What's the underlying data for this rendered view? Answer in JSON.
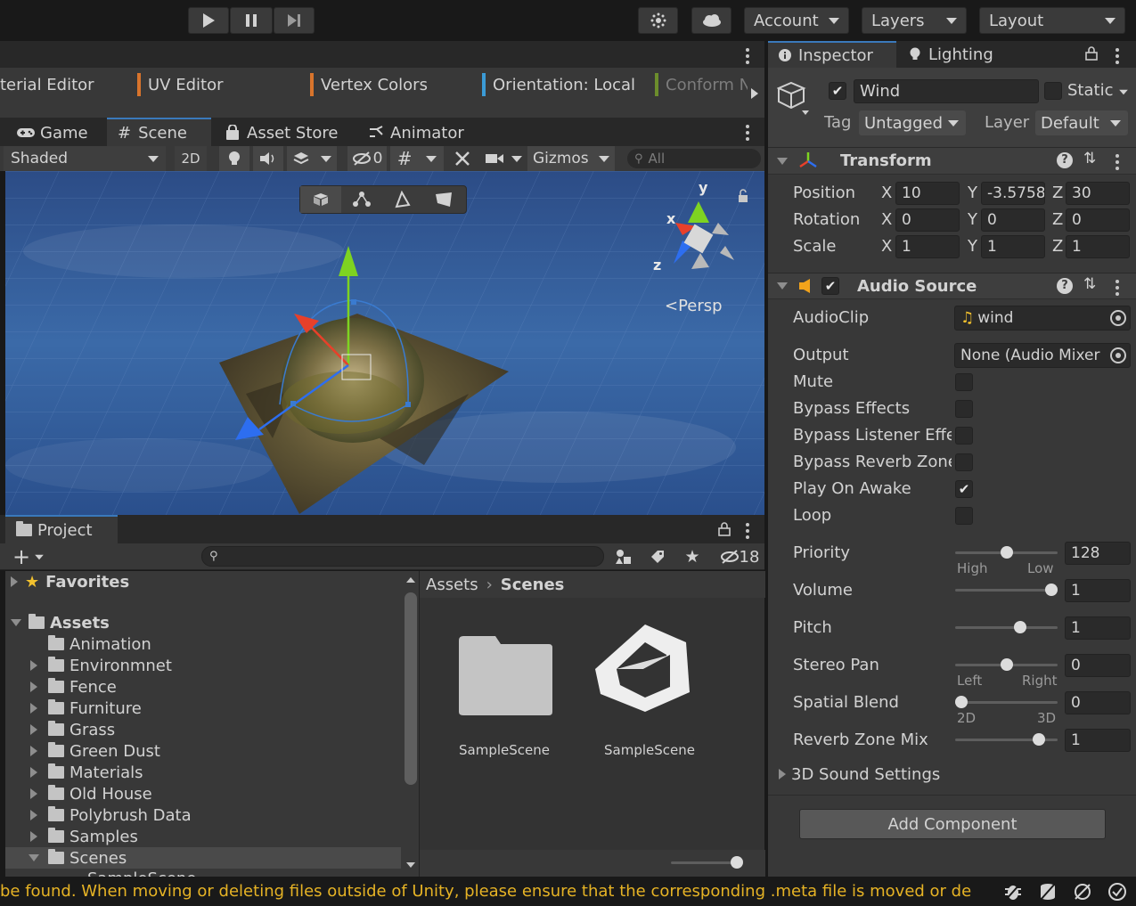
{
  "toolbar": {
    "account_label": "Account",
    "layers_label": "Layers",
    "layout_label": "Layout"
  },
  "polybrush_bar": {
    "items": [
      {
        "label": "terial Editor",
        "color": ""
      },
      {
        "label": "UV Editor",
        "color": "#d8742c"
      },
      {
        "label": "Vertex Colors",
        "color": "#d8742c"
      },
      {
        "label": "Orientation: Local",
        "color": "#3b9bd6"
      },
      {
        "label": "Conform No",
        "color": "#6c8d2c"
      }
    ]
  },
  "scene_tabs": [
    {
      "label": "Game",
      "icon": "gamepad-icon"
    },
    {
      "label": "Scene",
      "icon": "hash-icon"
    },
    {
      "label": "Asset Store",
      "icon": "bag-icon"
    },
    {
      "label": "Animator",
      "icon": "animator-icon"
    }
  ],
  "scene_toolbar": {
    "shading_mode": "Shaded",
    "mode_2d": "2D",
    "hidden_count": "0",
    "gizmos_label": "Gizmos",
    "search_placeholder": "All"
  },
  "scene_view": {
    "projection_label": "Persp",
    "axis_x": "x",
    "axis_y": "y",
    "axis_z": "z",
    "colors": {
      "x_axis": "#e8402a",
      "y_axis": "#7ed321",
      "z_axis": "#2d6ef0",
      "sky": "#3a5a8c"
    }
  },
  "project": {
    "tab_label": "Project",
    "hidden_count": "18",
    "breadcrumb": {
      "root": "Assets",
      "current": "Scenes"
    },
    "tree": [
      {
        "label": "Favorites",
        "level": 0,
        "expand": "collapsed",
        "icon": "star-icon",
        "bold": true
      },
      {
        "label": "Assets",
        "level": 0,
        "expand": "expanded",
        "icon": "folder-open-icon",
        "bold": true
      },
      {
        "label": "Animation",
        "level": 1,
        "expand": "none"
      },
      {
        "label": "Environmnet",
        "level": 1,
        "expand": "collapsed"
      },
      {
        "label": "Fence",
        "level": 1,
        "expand": "collapsed"
      },
      {
        "label": "Furniture",
        "level": 1,
        "expand": "collapsed"
      },
      {
        "label": "Grass",
        "level": 1,
        "expand": "collapsed"
      },
      {
        "label": "Green Dust",
        "level": 1,
        "expand": "collapsed"
      },
      {
        "label": "Materials",
        "level": 1,
        "expand": "collapsed"
      },
      {
        "label": "Old House",
        "level": 1,
        "expand": "collapsed"
      },
      {
        "label": "Polybrush Data",
        "level": 1,
        "expand": "collapsed"
      },
      {
        "label": "Samples",
        "level": 1,
        "expand": "collapsed"
      },
      {
        "label": "Scenes",
        "level": 1,
        "expand": "expanded",
        "selected": true
      },
      {
        "label": "SampleScene",
        "level": 2,
        "expand": "none"
      }
    ],
    "assets": [
      {
        "label": "SampleScene",
        "icon": "folder-icon"
      },
      {
        "label": "SampleScene",
        "icon": "unity-logo-icon"
      }
    ]
  },
  "inspector": {
    "tabs": [
      {
        "label": "Inspector",
        "icon": "info-icon"
      },
      {
        "label": "Lighting",
        "icon": "bulb-icon"
      }
    ],
    "object_name": "Wind",
    "static_label": "Static",
    "tag_label": "Tag",
    "tag_value": "Untagged",
    "layer_label": "Layer",
    "layer_value": "Default",
    "transform": {
      "title": "Transform",
      "rows": [
        {
          "label": "Position",
          "x": "10",
          "y": "-3.5758",
          "z": "30"
        },
        {
          "label": "Rotation",
          "x": "0",
          "y": "0",
          "z": "0"
        },
        {
          "label": "Scale",
          "x": "1",
          "y": "1",
          "z": "1"
        }
      ],
      "axis_labels": {
        "x": "X",
        "y": "Y",
        "z": "Z"
      }
    },
    "audio": {
      "title": "Audio Source",
      "audioclip_label": "AudioClip",
      "audioclip_value": "wind",
      "output_label": "Output",
      "output_value": "None (Audio Mixer",
      "toggles": [
        {
          "label": "Mute",
          "checked": false
        },
        {
          "label": "Bypass Effects",
          "checked": false
        },
        {
          "label": "Bypass Listener Effe",
          "checked": false
        },
        {
          "label": "Bypass Reverb Zone",
          "checked": false
        },
        {
          "label": "Play On Awake",
          "checked": true
        },
        {
          "label": "Loop",
          "checked": false
        }
      ],
      "sliders": [
        {
          "label": "Priority",
          "value": "128",
          "fraction": 0.5,
          "left": "High",
          "right": "Low"
        },
        {
          "label": "Volume",
          "value": "1",
          "fraction": 1.0,
          "left": "",
          "right": ""
        },
        {
          "label": "Pitch",
          "value": "1",
          "fraction": 0.65,
          "left": "",
          "right": ""
        },
        {
          "label": "Stereo Pan",
          "value": "0",
          "fraction": 0.5,
          "left": "Left",
          "right": "Right"
        },
        {
          "label": "Spatial Blend",
          "value": "0",
          "fraction": 0.0,
          "left": "2D",
          "right": "3D"
        },
        {
          "label": "Reverb Zone Mix",
          "value": "1",
          "fraction": 0.86,
          "left": "",
          "right": ""
        }
      ],
      "sound3d_label": "3D Sound Settings"
    },
    "add_component_label": "Add Component"
  },
  "status_bar": {
    "message": "be found. When moving or deleting files outside of Unity, please ensure that the corresponding .meta file is moved or delet",
    "color": "#e6b325"
  }
}
